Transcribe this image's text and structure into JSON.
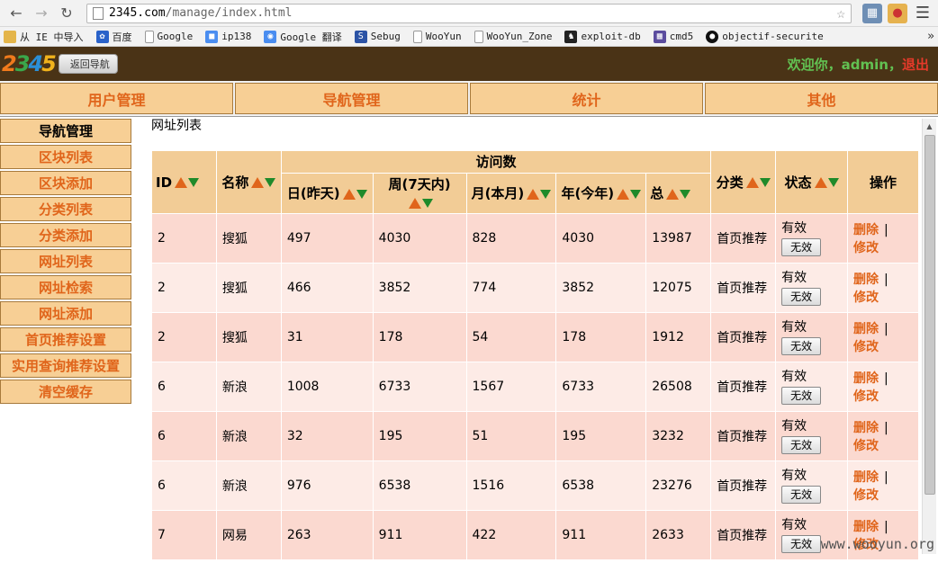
{
  "browser": {
    "url_host": "2345.com",
    "url_path": "/manage/index.html",
    "bookmarks": [
      {
        "label": "从 IE 中导入",
        "icon": "folder-icon"
      },
      {
        "label": "百度",
        "icon": "baidu-paw-icon"
      },
      {
        "label": "Google",
        "icon": "page-icon"
      },
      {
        "label": "ip138",
        "icon": "ip138-icon"
      },
      {
        "label": "Google 翻译",
        "icon": "google-translate-icon"
      },
      {
        "label": "Sebug",
        "icon": "sebug-icon"
      },
      {
        "label": "WooYun",
        "icon": "page-icon"
      },
      {
        "label": "WooYun_Zone",
        "icon": "page-icon"
      },
      {
        "label": "exploit-db",
        "icon": "exploit-db-icon"
      },
      {
        "label": "cmd5",
        "icon": "cmd5-icon"
      },
      {
        "label": "objectif-securite",
        "icon": "objectif-securite-icon"
      }
    ]
  },
  "header": {
    "logo": {
      "d2": "2",
      "d3": "3",
      "d4": "4",
      "d5": "5"
    },
    "back_nav": "返回导航",
    "welcome_prefix": "欢迎你，",
    "username": "admin",
    "separator": "，",
    "logout": "退出"
  },
  "topnav": [
    {
      "label": "用户管理"
    },
    {
      "label": "导航管理"
    },
    {
      "label": "统计"
    },
    {
      "label": "其他"
    }
  ],
  "sidebar": [
    {
      "label": "导航管理"
    },
    {
      "label": "区块列表"
    },
    {
      "label": "区块添加"
    },
    {
      "label": "分类列表"
    },
    {
      "label": "分类添加"
    },
    {
      "label": "网址列表"
    },
    {
      "label": "网址检索"
    },
    {
      "label": "网址添加"
    },
    {
      "label": "首页推荐设置"
    },
    {
      "label": "实用查询推荐设置"
    },
    {
      "label": "清空缓存"
    }
  ],
  "main": {
    "title": "网址列表",
    "columns": {
      "id": "ID",
      "name": "名称",
      "visits": "访问数",
      "day": "日(昨天)",
      "week": "周(7天内)",
      "month": "月(本月)",
      "year": "年(今年)",
      "total": "总",
      "category": "分类",
      "status": "状态",
      "ops": "操作"
    },
    "rows": [
      {
        "id": "2",
        "name": "搜狐",
        "day": "497",
        "week": "4030",
        "month": "828",
        "year": "4030",
        "total": "13987",
        "category": "首页推荐",
        "status": "有效",
        "btn": "无效",
        "del": "删除",
        "edit": "修改",
        "sep": "|"
      },
      {
        "id": "2",
        "name": "搜狐",
        "day": "466",
        "week": "3852",
        "month": "774",
        "year": "3852",
        "total": "12075",
        "category": "首页推荐",
        "status": "有效",
        "btn": "无效",
        "del": "删除",
        "edit": "修改",
        "sep": "|"
      },
      {
        "id": "2",
        "name": "搜狐",
        "day": "31",
        "week": "178",
        "month": "54",
        "year": "178",
        "total": "1912",
        "category": "首页推荐",
        "status": "有效",
        "btn": "无效",
        "del": "删除",
        "edit": "修改",
        "sep": "|"
      },
      {
        "id": "6",
        "name": "新浪",
        "day": "1008",
        "week": "6733",
        "month": "1567",
        "year": "6733",
        "total": "26508",
        "category": "首页推荐",
        "status": "有效",
        "btn": "无效",
        "del": "删除",
        "edit": "修改",
        "sep": "|"
      },
      {
        "id": "6",
        "name": "新浪",
        "day": "32",
        "week": "195",
        "month": "51",
        "year": "195",
        "total": "3232",
        "category": "首页推荐",
        "status": "有效",
        "btn": "无效",
        "del": "删除",
        "edit": "修改",
        "sep": "|"
      },
      {
        "id": "6",
        "name": "新浪",
        "day": "976",
        "week": "6538",
        "month": "1516",
        "year": "6538",
        "total": "23276",
        "category": "首页推荐",
        "status": "有效",
        "btn": "无效",
        "del": "删除",
        "edit": "修改",
        "sep": "|"
      },
      {
        "id": "7",
        "name": "网易",
        "day": "263",
        "week": "911",
        "month": "422",
        "year": "911",
        "total": "2633",
        "category": "首页推荐",
        "status": "有效",
        "btn": "无效",
        "del": "删除",
        "edit": "修改",
        "sep": "|"
      }
    ]
  },
  "watermark": "www.wooyun.org"
}
